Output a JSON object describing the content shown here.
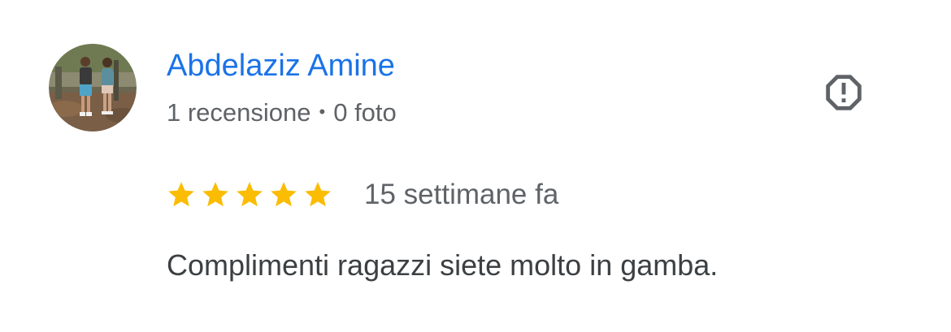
{
  "review": {
    "author_name": "Abdelaziz Amine",
    "review_count": "1 recensione",
    "separator": "•",
    "photo_count": "0 foto",
    "rating": 5,
    "max_rating": 5,
    "time_ago": "15 settimane fa",
    "text": "Complimenti ragazzi siete molto in gamba."
  },
  "icons": {
    "avatar": "avatar-photo",
    "report": "report-octagon-exclamation-icon",
    "star": "star-icon"
  },
  "colors": {
    "author_link": "#1a73e8",
    "meta_text": "#5f6368",
    "body_text": "#3c4043",
    "star_fill": "#fbbc04",
    "report_icon": "#5f6368"
  }
}
